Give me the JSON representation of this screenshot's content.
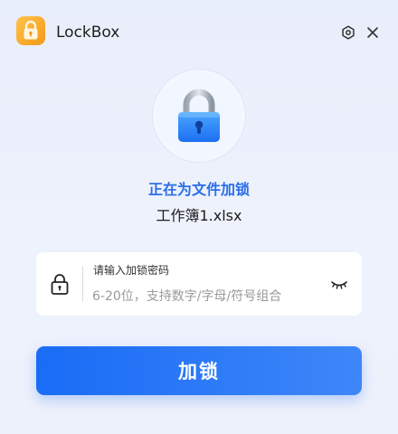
{
  "app": {
    "title": "LockBox",
    "logo_icon": "lock-app-logo",
    "brand_color": "#f5a623"
  },
  "titlebar": {
    "settings_icon": "gear-icon",
    "close_icon": "close-icon"
  },
  "hero": {
    "icon": "padlock-icon",
    "status": "正在为文件加锁",
    "status_color": "#2b6fe8",
    "file_name": "工作簿1.xlsx"
  },
  "password": {
    "label": "请输入加锁密码",
    "placeholder": "6-20位，支持数字/字母/符号组合",
    "value": "",
    "lock_icon": "lock-outline-icon",
    "visibility_icon": "eye-closed-icon"
  },
  "action": {
    "label": "加锁",
    "color": "#1a6cf6"
  }
}
